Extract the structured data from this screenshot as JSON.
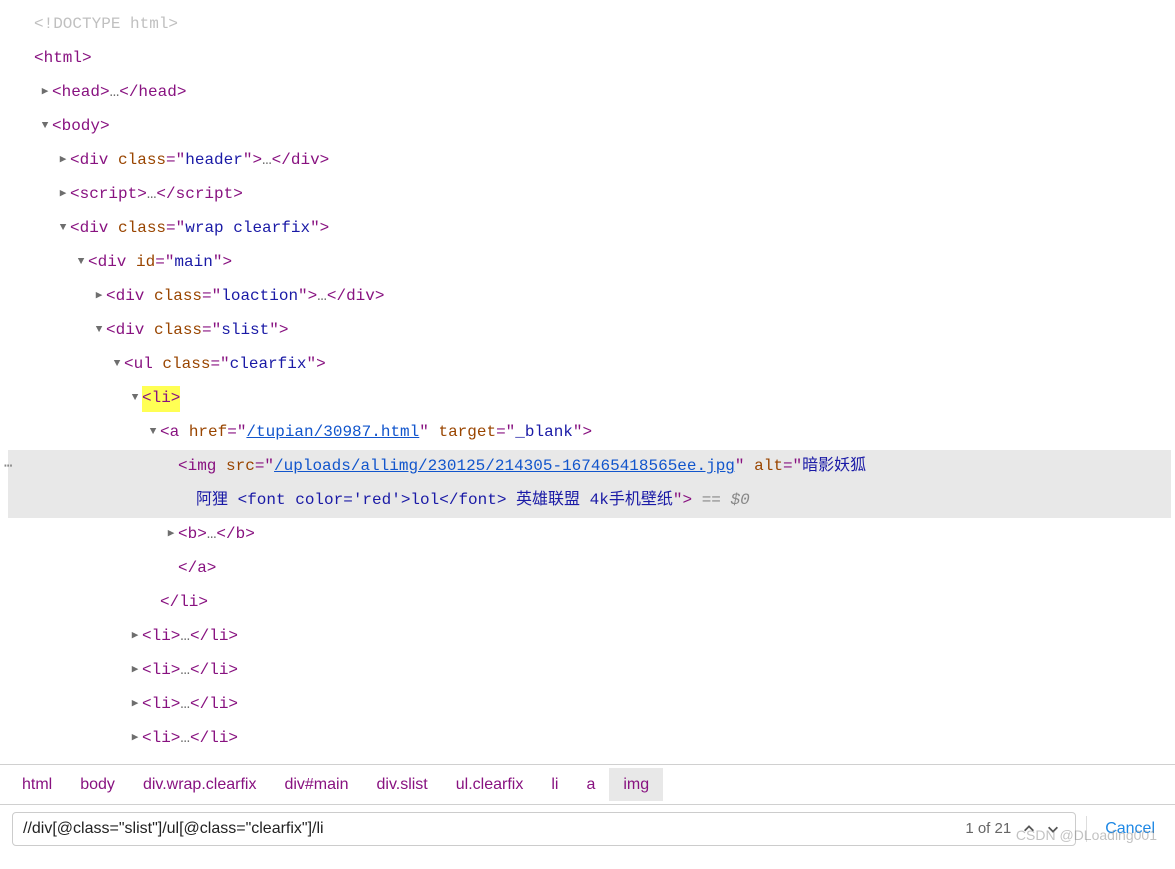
{
  "dom": {
    "doctype": "<!DOCTYPE html>",
    "html_open": "<html>",
    "headLine": {
      "open": "<head>",
      "ellipsis": "…",
      "close": "</head>"
    },
    "bodyLine": {
      "open": "<body>"
    },
    "divHeader": {
      "open": "<div",
      "attrName": "class",
      "attrVal": "header",
      "mid": ">",
      "ellipsis": "…",
      "close": "</div>"
    },
    "scriptLine": {
      "open": "<script>",
      "ellipsis": "…",
      "close": "</script>"
    },
    "divWrap": {
      "open": "<div",
      "attrName": "class",
      "attrVal": "wrap clearfix",
      "close": ">"
    },
    "divMain": {
      "open": "<div",
      "attrName": "id",
      "attrVal": "main",
      "close": ">"
    },
    "divLoaction": {
      "open": "<div",
      "attrName": "class",
      "attrVal": "loaction",
      "mid": ">",
      "ellipsis": "…",
      "close": "</div>"
    },
    "divSlist": {
      "open": "<div",
      "attrName": "class",
      "attrVal": "slist",
      "close": ">"
    },
    "ulClearfix": {
      "open": "<ul",
      "attrName": "class",
      "attrVal": "clearfix",
      "close": ">"
    },
    "liOpen": "<li>",
    "aLine": {
      "open": "<a",
      "hrefName": "href",
      "hrefVal": "/tupian/30987.html",
      "targetName": "target",
      "targetVal": "_blank",
      "close": ">"
    },
    "imgLine": {
      "open": "<img",
      "srcName": "src",
      "srcVal": "/uploads/allimg/230125/214305-167465418565ee.jpg",
      "altName": "alt",
      "altPart1": "暗影妖狐",
      "altPart2": "阿狸 <font color='red'>lol</font> 英雄联盟 4k手机壁纸",
      "close": ">",
      "eq0": "== $0"
    },
    "bLine": {
      "open": "<b>",
      "ellipsis": "…",
      "close": "</b>"
    },
    "aClose": "</a>",
    "liClose": "</li>",
    "liItems": [
      {
        "open": "<li>",
        "ellipsis": "…",
        "close": "</li>"
      },
      {
        "open": "<li>",
        "ellipsis": "…",
        "close": "</li>"
      },
      {
        "open": "<li>",
        "ellipsis": "…",
        "close": "</li>"
      },
      {
        "open": "<li>",
        "ellipsis": "…",
        "close": "</li>"
      }
    ]
  },
  "breadcrumb": {
    "items": [
      "html",
      "body",
      "div.wrap.clearfix",
      "div#main",
      "div.slist",
      "ul.clearfix",
      "li",
      "a",
      "img"
    ]
  },
  "search": {
    "value": "//div[@class=\"slist\"]/ul[@class=\"clearfix\"]/li",
    "count": "1 of 21",
    "cancelLabel": "Cancel"
  },
  "watermark": "CSDN @DLoading001"
}
